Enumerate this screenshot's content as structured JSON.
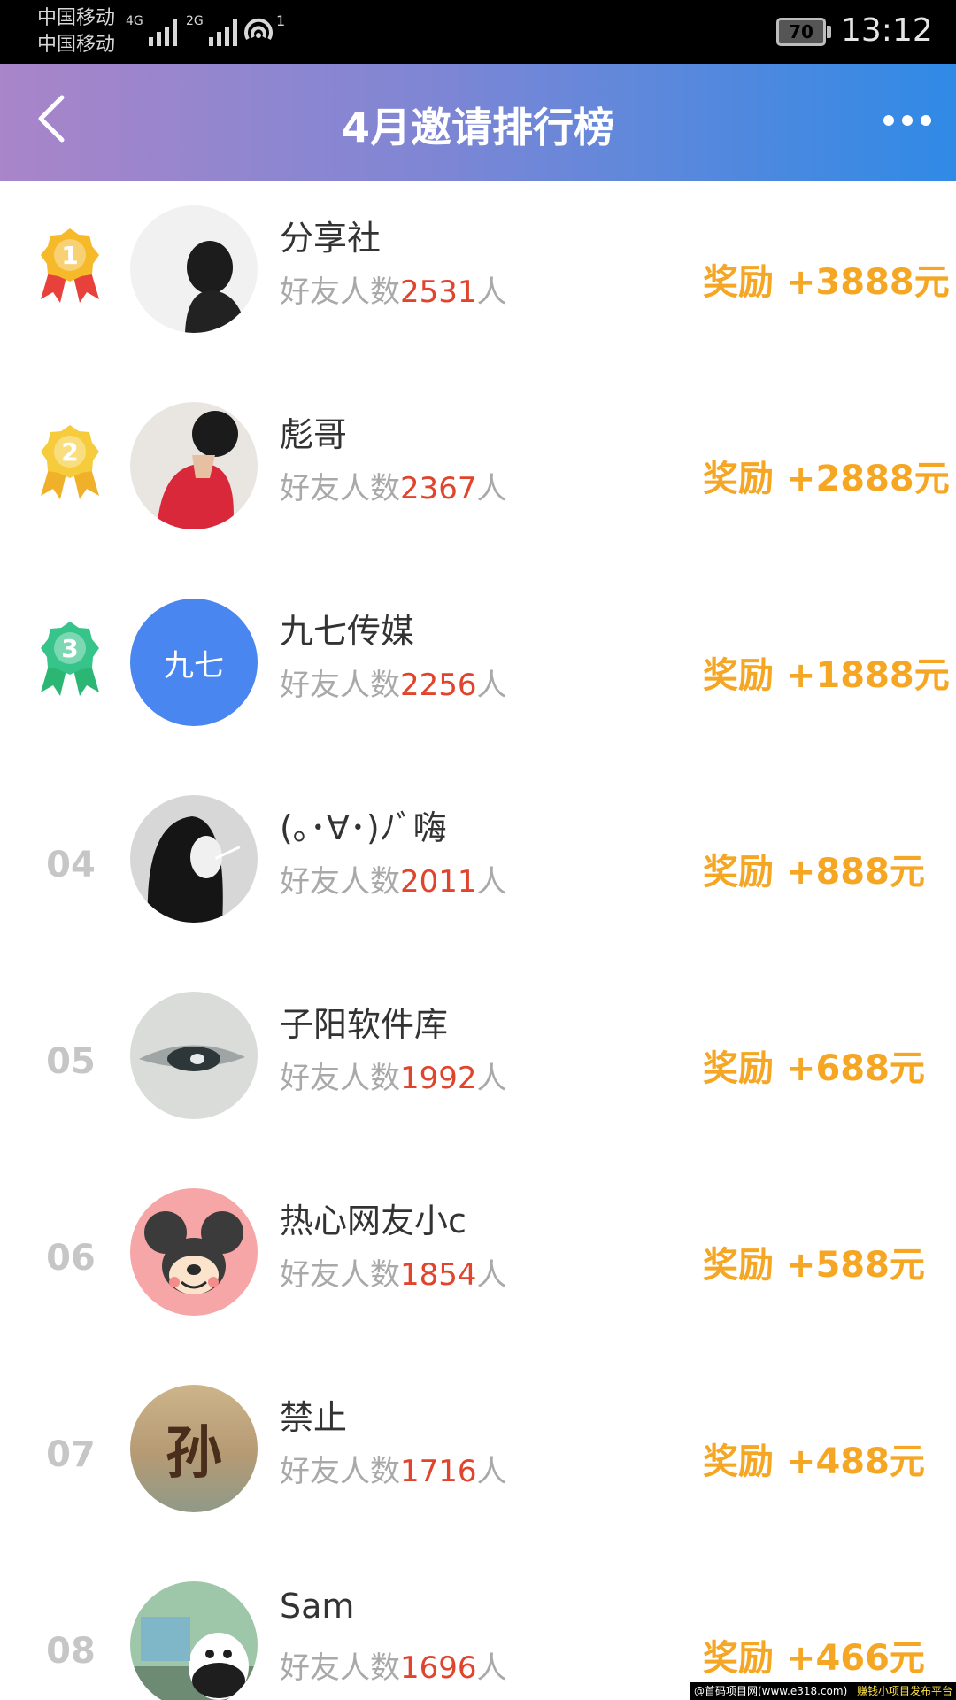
{
  "status_bar": {
    "carrier_1": "中国移动",
    "carrier_2": "中国移动",
    "network_1": "4G",
    "network_2": "2G",
    "hotspot_count": "1",
    "battery": "70",
    "time": "13:12"
  },
  "header": {
    "title": "4月邀请排行榜",
    "back_icon": "chevron-left-icon",
    "more_icon": "more-dots-icon"
  },
  "labels": {
    "friends_prefix": "好友人数",
    "friends_suffix": "人"
  },
  "medal_colors": {
    "1": "#f5b92a",
    "2": "#f6cc3c",
    "3": "#37c48a"
  },
  "ribbon_colors": {
    "1": "#e8413b",
    "2": "#f0b02a",
    "3": "#2bb673"
  },
  "ranking": [
    {
      "rank": "1",
      "name": "分享社",
      "friends": "2531",
      "reward": "奖励 +3888元",
      "avatar": "silhouette-photo"
    },
    {
      "rank": "2",
      "name": "彪哥",
      "friends": "2367",
      "reward": "奖励 +2888元",
      "avatar": "red-shirt-photo"
    },
    {
      "rank": "3",
      "name": "九七传媒",
      "friends": "2256",
      "reward": "奖励 +1888元",
      "avatar_text": "九七",
      "avatar_color": "#4a86f0"
    },
    {
      "rank": "04",
      "name": "(｡･∀･)ﾉﾞ嗨",
      "friends": "2011",
      "reward": "奖励 +888元",
      "avatar": "bw-portrait-photo"
    },
    {
      "rank": "05",
      "name": "子阳软件库",
      "friends": "1992",
      "reward": "奖励 +688元",
      "avatar": "eye-photo"
    },
    {
      "rank": "06",
      "name": "热心网友小c",
      "friends": "1854",
      "reward": "奖励 +588元",
      "avatar": "mickey-icon"
    },
    {
      "rank": "07",
      "name": "禁止",
      "friends": "1716",
      "reward": "奖励 +488元",
      "avatar_text": "孙"
    },
    {
      "rank": "08",
      "name": "Sam",
      "friends": "1696",
      "reward": "奖励 +466元",
      "avatar": "panda-cartoon"
    }
  ],
  "watermark": {
    "left": "@首码项目网(www.e318.com)",
    "right": "赚钱小项目发布平台"
  }
}
